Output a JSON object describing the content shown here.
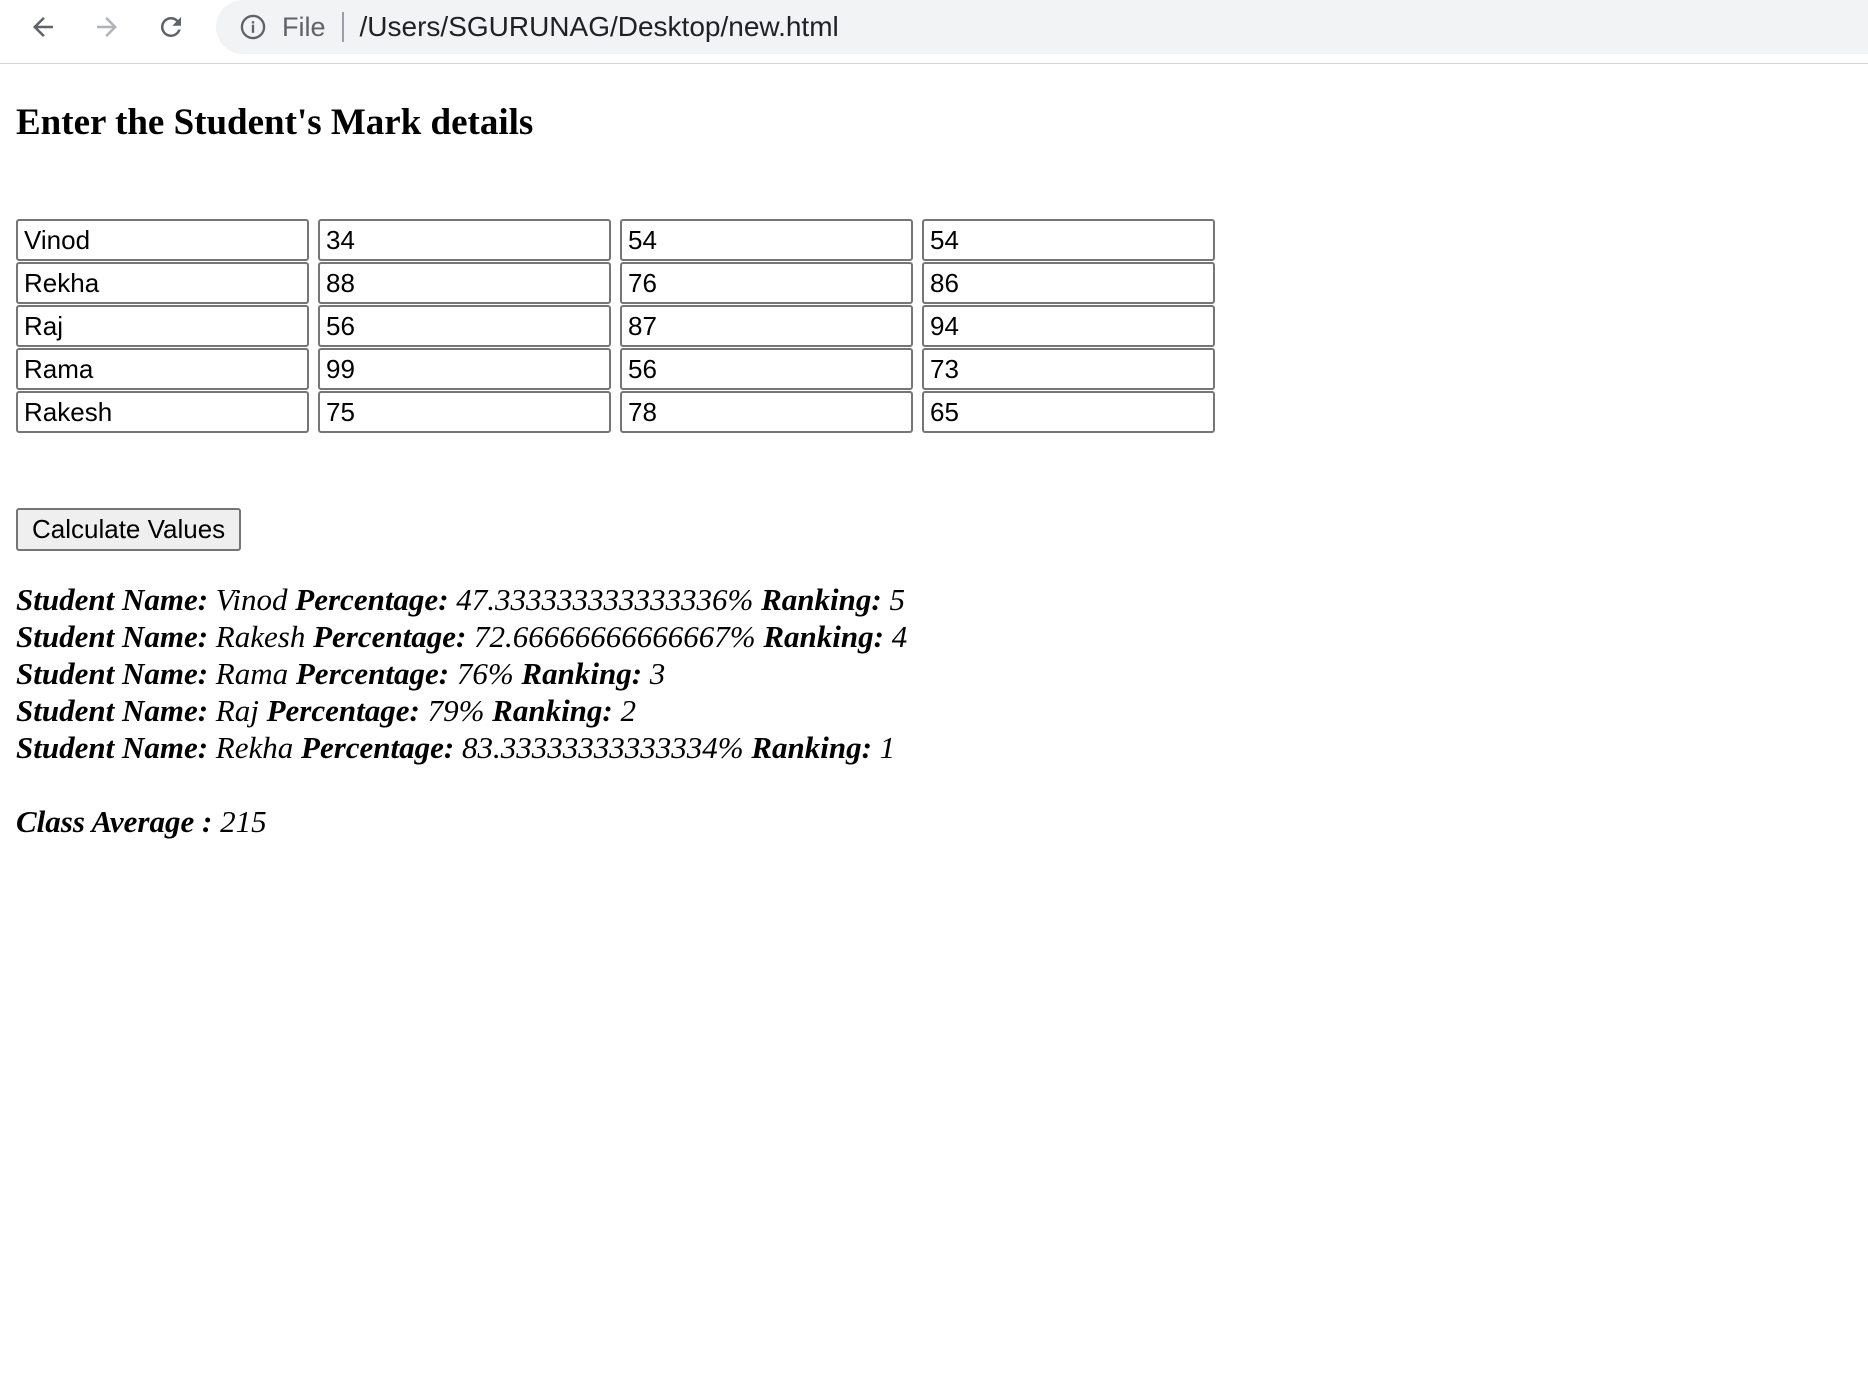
{
  "browser": {
    "scheme_label": "File",
    "url": "/Users/SGURUNAG/Desktop/new.html"
  },
  "page": {
    "title": "Enter the Student's Mark details"
  },
  "students": [
    {
      "name": "Vinod",
      "m1": "34",
      "m2": "54",
      "m3": "54"
    },
    {
      "name": "Rekha",
      "m1": "88",
      "m2": "76",
      "m3": "86"
    },
    {
      "name": "Raj",
      "m1": "56",
      "m2": "87",
      "m3": "94"
    },
    {
      "name": "Rama",
      "m1": "99",
      "m2": "56",
      "m3": "73"
    },
    {
      "name": "Rakesh",
      "m1": "75",
      "m2": "78",
      "m3": "65"
    }
  ],
  "calculate_label": "Calculate Values",
  "result_labels": {
    "name": "Student Name:",
    "percentage": "Percentage:",
    "ranking": "Ranking:"
  },
  "results": [
    {
      "name": "Vinod",
      "percentage": "47.333333333333336%",
      "ranking": "5"
    },
    {
      "name": "Rakesh",
      "percentage": "72.66666666666667%",
      "ranking": "4"
    },
    {
      "name": "Rama",
      "percentage": "76%",
      "ranking": "3"
    },
    {
      "name": "Raj",
      "percentage": "79%",
      "ranking": "2"
    },
    {
      "name": "Rekha",
      "percentage": "83.33333333333334%",
      "ranking": "1"
    }
  ],
  "class_average": {
    "label": "Class Average :",
    "value": "215"
  }
}
